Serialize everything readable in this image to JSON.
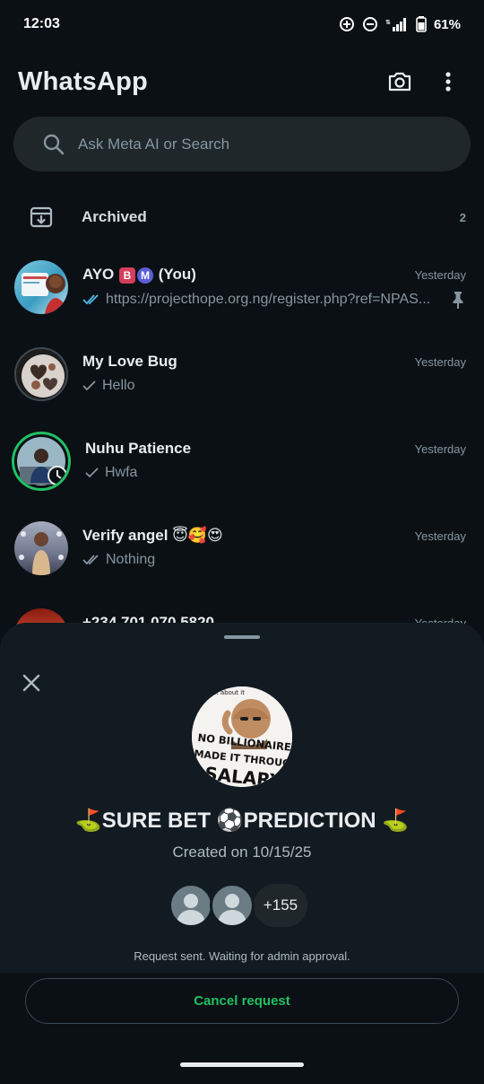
{
  "status_bar": {
    "time": "12:03",
    "battery": "61%"
  },
  "header": {
    "title": "WhatsApp"
  },
  "search": {
    "placeholder": "Ask Meta AI or Search"
  },
  "archived": {
    "label": "Archived",
    "count": "2"
  },
  "chats": [
    {
      "name": "AYO",
      "name_suffix": "(You)",
      "badges": [
        "B",
        "M"
      ],
      "time": "Yesterday",
      "preview": "https://projecthope.org.ng/register.php?ref=NPAS...",
      "tick": "double-read",
      "pinned": true
    },
    {
      "name": "My Love Bug",
      "time": "Yesterday",
      "preview": "Hello",
      "tick": "single"
    },
    {
      "name": "Nuhu Patience",
      "time": "Yesterday",
      "preview": "Hwfa",
      "tick": "single"
    },
    {
      "name": "Verify angel 😇🥰😍",
      "time": "Yesterday",
      "preview": "Nothing",
      "tick": "double"
    },
    {
      "name": "+234 701 070 5820",
      "time": "Yesterday",
      "preview": "",
      "tick": ""
    }
  ],
  "sheet": {
    "group_name": "⛳SURE BET ⚽PREDICTION ⛳",
    "created": "Created on 10/15/25",
    "avatar_text_top": "think about it",
    "avatar_text_line1": "NO BILLIONAIRE",
    "avatar_text_line2": "MADE IT THROUGH",
    "avatar_text_line3": "SALARY",
    "members_more": "+155",
    "request_status": "Request sent. Waiting for admin approval.",
    "cancel_label": "Cancel request"
  },
  "colors": {
    "accent": "#21c063",
    "read_tick": "#53bdeb",
    "background": "#0b1014"
  }
}
